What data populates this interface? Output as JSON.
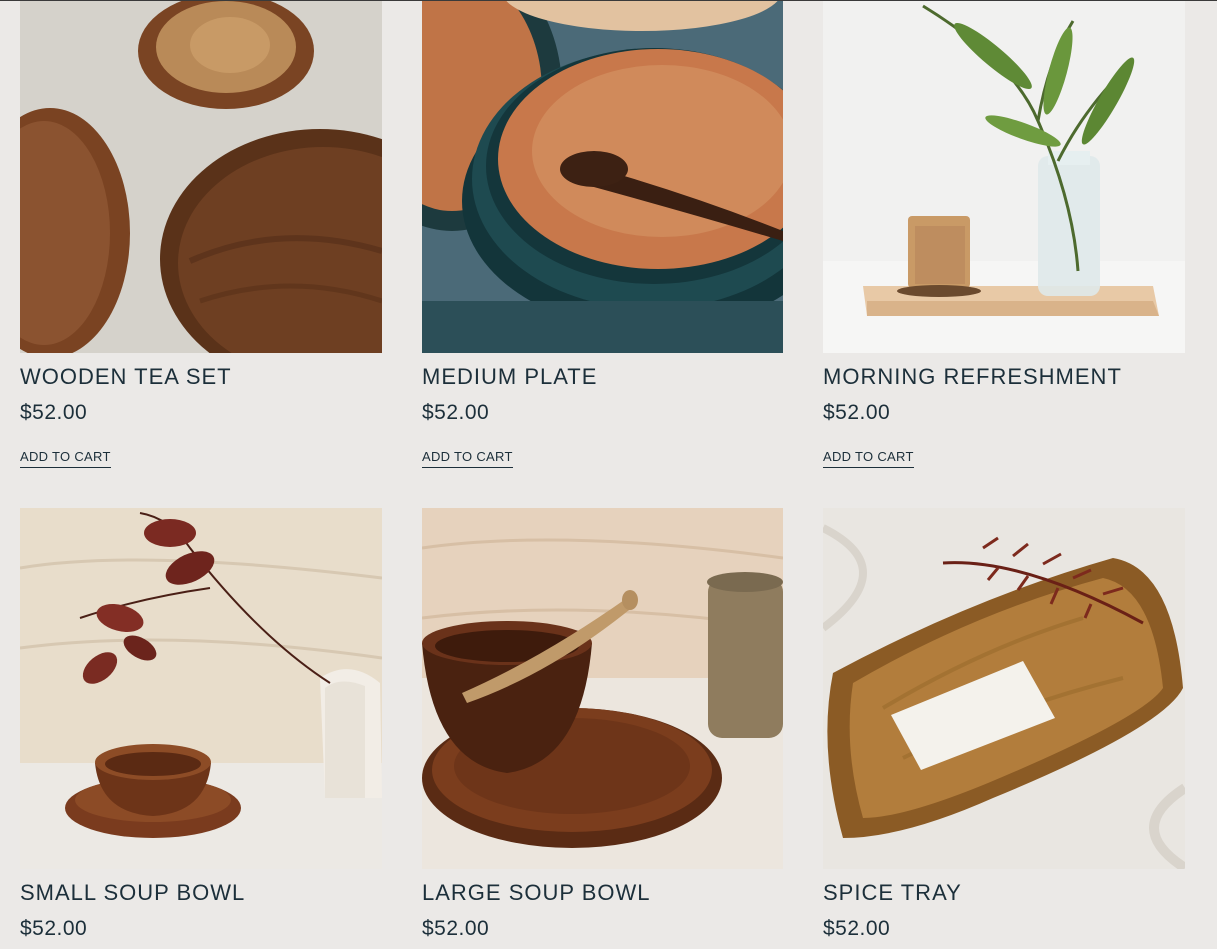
{
  "products": [
    {
      "title": "WOODEN TEA SET",
      "price": "$52.00",
      "cart_label": "ADD TO CART"
    },
    {
      "title": "MEDIUM PLATE",
      "price": "$52.00",
      "cart_label": "ADD TO CART"
    },
    {
      "title": "MORNING REFRESHMENT",
      "price": "$52.00",
      "cart_label": "ADD TO CART"
    },
    {
      "title": "SMALL SOUP BOWL",
      "price": "$52.00"
    },
    {
      "title": "LARGE SOUP BOWL",
      "price": "$52.00"
    },
    {
      "title": "SPICE TRAY",
      "price": "$52.00"
    }
  ],
  "colors": {
    "background": "#ebe9e7",
    "text": "#1c2f3a"
  }
}
